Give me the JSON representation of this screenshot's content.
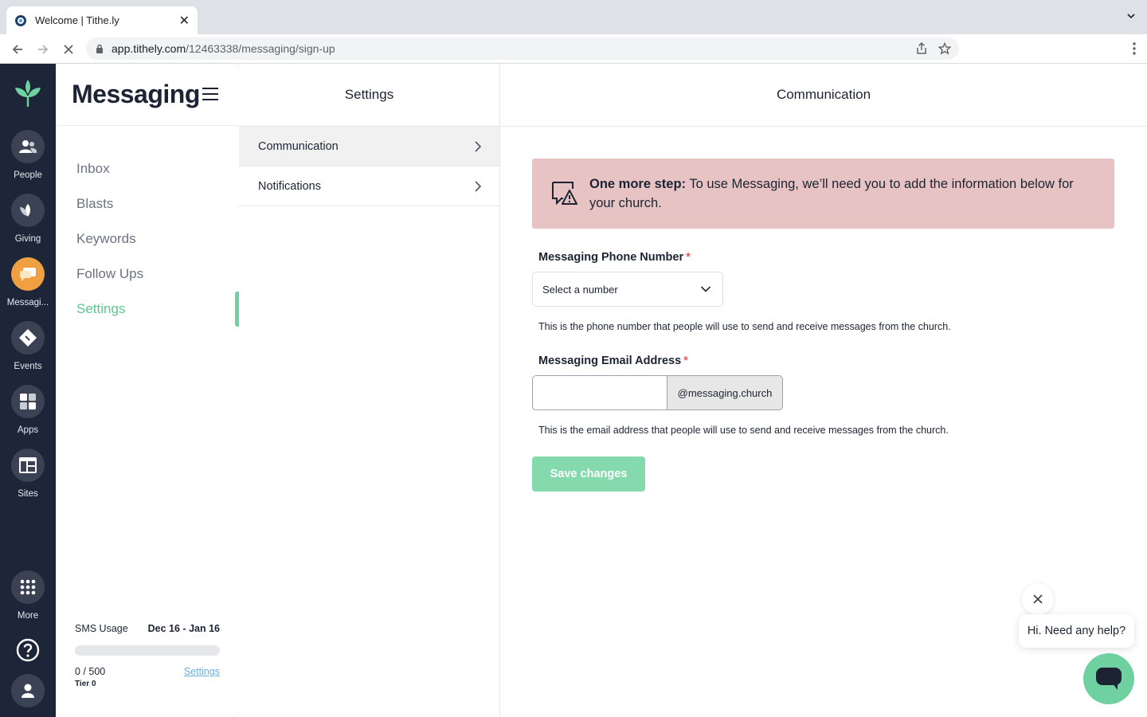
{
  "browser": {
    "tab_title": "Welcome | Tithe.ly",
    "url_host": "app.tithely.com",
    "url_path": "/12463338/messaging/sign-up"
  },
  "rail": {
    "items": [
      {
        "label": "People",
        "icon": "people-icon"
      },
      {
        "label": "Giving",
        "icon": "giving-leaf-icon"
      },
      {
        "label": "Messagi...",
        "icon": "chat-icon"
      },
      {
        "label": "Events",
        "icon": "ticket-icon"
      },
      {
        "label": "Apps",
        "icon": "apps-grid-icon"
      },
      {
        "label": "Sites",
        "icon": "sites-layout-icon"
      }
    ],
    "more_label": "More"
  },
  "sidebar": {
    "title": "Messaging",
    "items": [
      {
        "label": "Inbox"
      },
      {
        "label": "Blasts"
      },
      {
        "label": "Keywords"
      },
      {
        "label": "Follow Ups"
      },
      {
        "label": "Settings"
      }
    ],
    "active_item": "Settings",
    "usage": {
      "label": "SMS Usage",
      "dates": "Dec 16 - Jan 16",
      "count": "0 / 500",
      "progress": 0,
      "link": "Settings",
      "tier": "Tier 0"
    }
  },
  "settings": {
    "title": "Settings",
    "items": [
      {
        "label": "Communication"
      },
      {
        "label": "Notifications"
      }
    ],
    "active_item": "Communication"
  },
  "main": {
    "title": "Communication",
    "alert": {
      "strong": "One more step:",
      "text": " To use Messaging, we’ll need you to add the information below for your church."
    },
    "phone": {
      "label": "Messaging Phone Number",
      "required": "*",
      "select_value": "Select a number",
      "help": "This is the phone number that people will use to send and receive messages from the church."
    },
    "email": {
      "label": "Messaging Email Address",
      "required": "*",
      "value": "",
      "suffix": "@messaging.church",
      "help": "This is the email address that people will use to send and receive messages from the church."
    },
    "save_label": "Save changes"
  },
  "help_widget": {
    "message": "Hi. Need any help?"
  },
  "colors": {
    "rail_bg": "#1d2538",
    "accent_green": "#6fd19f",
    "active_orange": "#f0a042",
    "alert_bg": "#e8c3c3",
    "save_bg": "#84d9ad"
  }
}
